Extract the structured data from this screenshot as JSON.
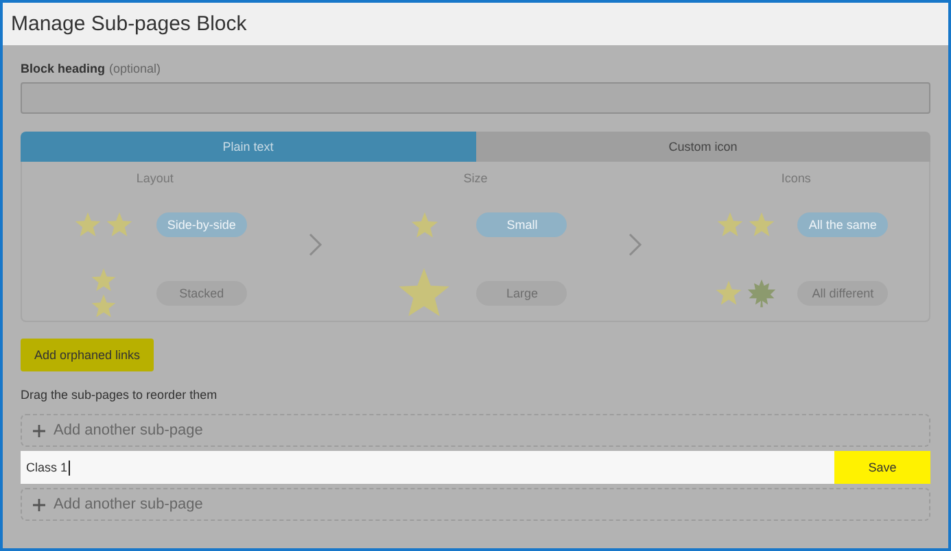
{
  "window": {
    "title": "Manage Sub-pages Block"
  },
  "heading_field": {
    "label": "Block heading",
    "hint": "(optional)"
  },
  "tabs": [
    {
      "label": "Plain text",
      "selected": true
    },
    {
      "label": "Custom icon",
      "selected": false
    }
  ],
  "option_groups": [
    {
      "title": "Layout",
      "options": [
        {
          "label": "Side-by-side",
          "kind": "pair",
          "selected": true
        },
        {
          "label": "Stacked",
          "kind": "stacked",
          "selected": false
        }
      ]
    },
    {
      "title": "Size",
      "options": [
        {
          "label": "Small",
          "kind": "small",
          "selected": true
        },
        {
          "label": "Large",
          "kind": "large",
          "selected": false
        }
      ]
    },
    {
      "title": "Icons",
      "options": [
        {
          "label": "All the same",
          "kind": "pair",
          "selected": true
        },
        {
          "label": "All different",
          "kind": "mixed",
          "selected": false
        }
      ]
    }
  ],
  "orphan_button": "Add orphaned links",
  "instructions": "Drag the sub-pages to reorder them",
  "subpages": [
    {
      "kind": "add",
      "label": "Add another sub-page"
    },
    {
      "kind": "edit",
      "value": "Class 1",
      "button": "Save"
    },
    {
      "kind": "add",
      "label": "Add another sub-page"
    }
  ]
}
